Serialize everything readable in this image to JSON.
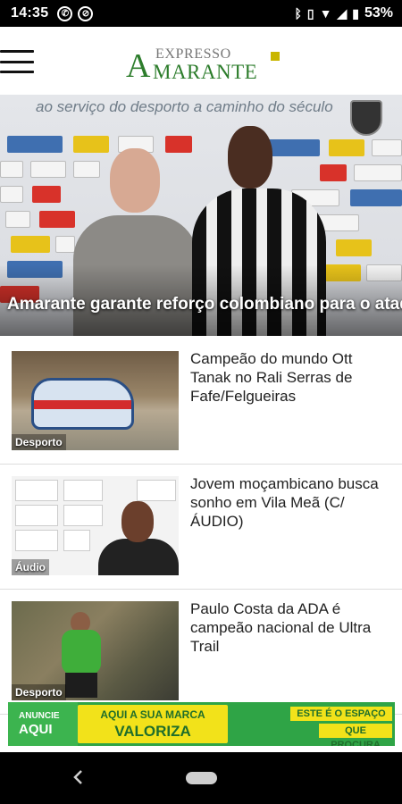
{
  "status_bar": {
    "time": "14:35",
    "left_icons": [
      "whatsapp-icon",
      "blocked-icon"
    ],
    "right_icons": [
      "bluetooth-icon",
      "vibrate-icon",
      "wifi-icon",
      "signal-icon",
      "battery-icon"
    ],
    "battery": "53%"
  },
  "header": {
    "menu_icon": "hamburger-menu-icon",
    "logo_top": "EXPRESSO",
    "logo_bigA": "A",
    "logo_main": "MARANTE",
    "brand_color": "#2d7d2c"
  },
  "hero": {
    "slogan": "ao serviço do desporto a caminho do século",
    "headline": "Amarante garante reforço colombiano para o ataque"
  },
  "articles": [
    {
      "category": "Desporto",
      "title": "Campeão do mundo Ott Tanak no Rali Serras de Fafe/Felgueiras"
    },
    {
      "category": "Áudio",
      "title": "Jovem moçambicano busca sonho em Vila Meã (C/ÁUDIO)"
    },
    {
      "category": "Desporto",
      "title": "Paulo Costa da ADA é campeão nacional de Ultra Trail"
    }
  ],
  "ad": {
    "left_small": "ANUNCIE",
    "left_big": "AQUI",
    "center_line1": "AQUI A SUA MARCA",
    "center_line2": "VALORIZA",
    "right_line1": "ESTE É O ESPAÇO",
    "right_line2": "QUE PROCURA",
    "colors": {
      "green": "#2fa446",
      "yellow": "#f2e21a"
    }
  },
  "navbar": {
    "back_icon": "back-triangle-icon",
    "home_icon": "home-pill-icon"
  }
}
